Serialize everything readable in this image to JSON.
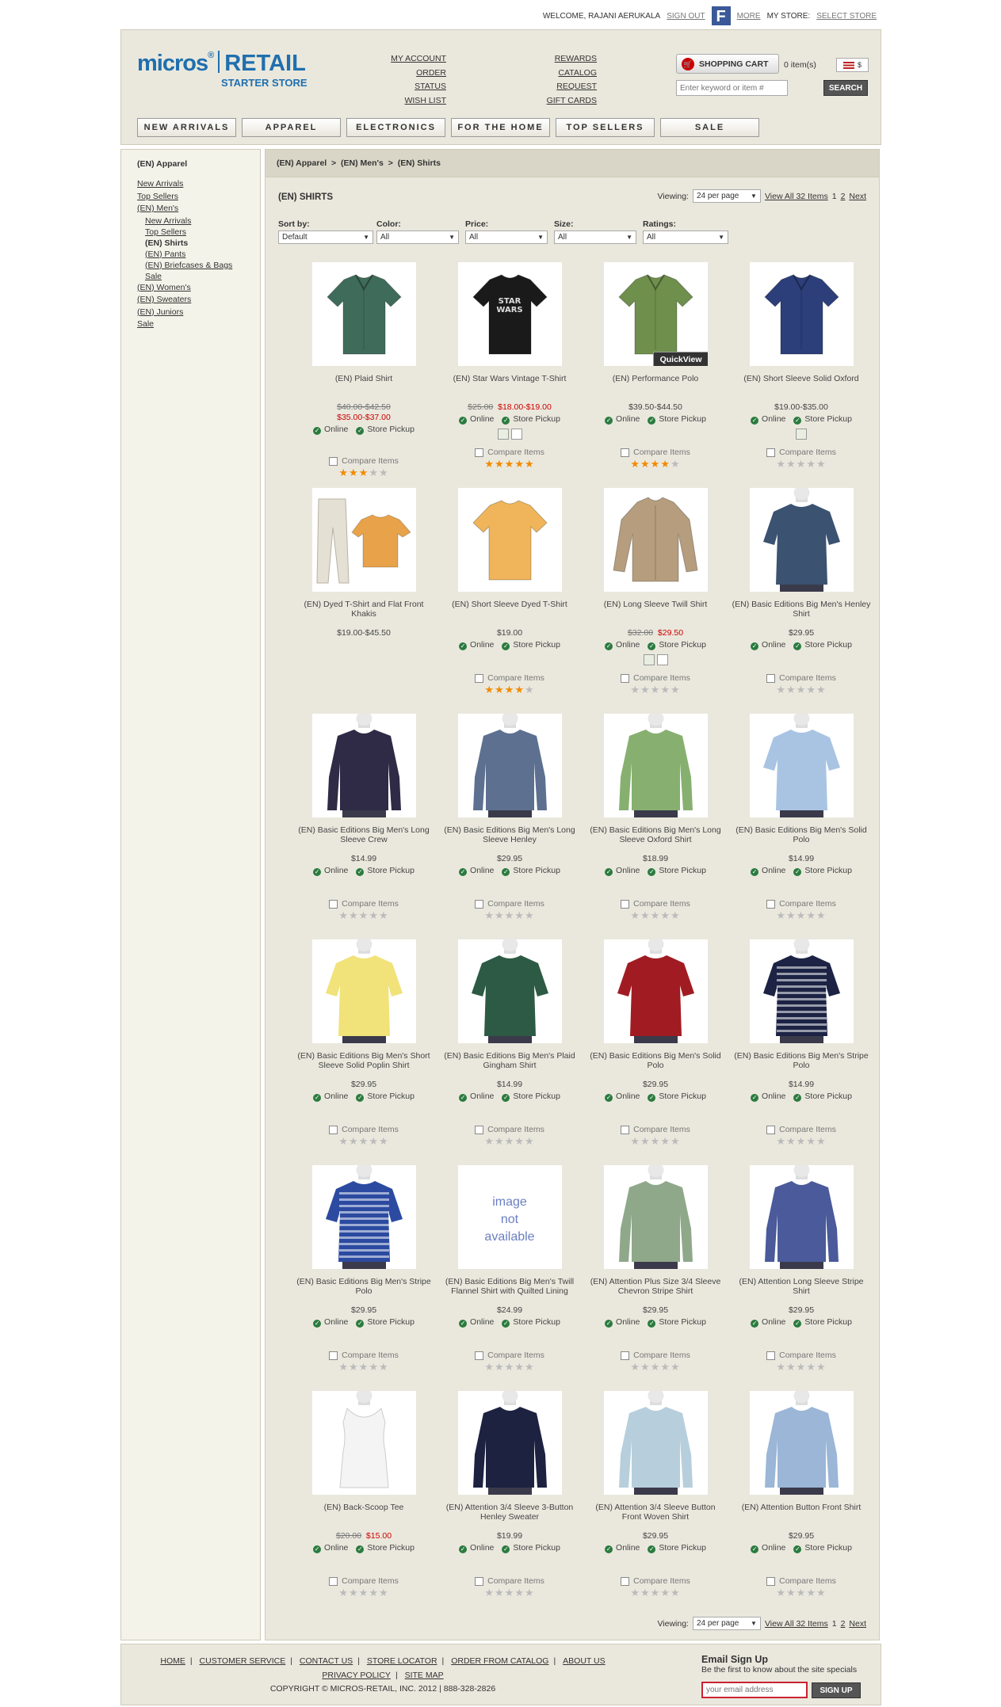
{
  "topbar": {
    "welcome": "WELCOME, RAJANI AERUKALA",
    "sign_out": "SIGN OUT",
    "fb_more": "MORE",
    "my_store": "MY STORE:",
    "select_store": "SELECT STORE"
  },
  "logo": {
    "brand": "micros",
    "brand2": "RETAIL",
    "tagline": "STARTER STORE"
  },
  "account_links": [
    "MY ACCOUNT",
    "ORDER STATUS",
    "WISH LIST"
  ],
  "account_links2": [
    "REWARDS",
    "CATALOG REQUEST",
    "GIFT CARDS"
  ],
  "cart": {
    "label": "SHOPPING CART",
    "items": "0 item(s)",
    "currency": "$"
  },
  "search": {
    "placeholder": "Enter keyword or item #",
    "button": "SEARCH"
  },
  "nav": [
    "NEW ARRIVALS",
    "APPAREL",
    "ELECTRONICS",
    "FOR THE HOME",
    "TOP SELLERS",
    "SALE"
  ],
  "sidebar": {
    "heading": "(EN) Apparel",
    "links": [
      {
        "label": "New Arrivals",
        "level": 0
      },
      {
        "label": "Top Sellers",
        "level": 0
      },
      {
        "label": "(EN) Men's",
        "level": 0
      },
      {
        "label": "New Arrivals",
        "level": 1
      },
      {
        "label": "Top Sellers",
        "level": 1
      },
      {
        "label": "(EN) Shirts",
        "level": 1,
        "current": true
      },
      {
        "label": "(EN) Pants",
        "level": 1
      },
      {
        "label": "(EN) Briefcases & Bags",
        "level": 1
      },
      {
        "label": "Sale",
        "level": 1
      },
      {
        "label": "(EN) Women's",
        "level": 0
      },
      {
        "label": "(EN) Sweaters",
        "level": 0
      },
      {
        "label": "(EN) Juniors",
        "level": 0
      },
      {
        "label": "Sale",
        "level": 0
      }
    ]
  },
  "breadcrumb": [
    "(EN) Apparel",
    ">",
    "(EN) Men's",
    ">",
    "(EN) Shirts"
  ],
  "page_title": "(EN) SHIRTS",
  "viewing": {
    "label": "Viewing:",
    "per_page": "24 per page",
    "view_all": "View All 32 Items",
    "page1": "1",
    "page2": "2",
    "next": "Next"
  },
  "filters": [
    {
      "label": "Sort by:",
      "value": "Default"
    },
    {
      "label": "Color:",
      "value": "All"
    },
    {
      "label": "Price:",
      "value": "All"
    },
    {
      "label": "Size:",
      "value": "All"
    },
    {
      "label": "Ratings:",
      "value": "All"
    }
  ],
  "labels": {
    "online": "Online",
    "pickup": "Store Pickup",
    "compare": "Compare Items",
    "quickview": "QuickView",
    "no_image": "image not available"
  },
  "products": [
    {
      "name": "(EN) Plaid Shirt",
      "old": "$40.00-$42.50",
      "price": "$35.00-$37.00",
      "sale": true,
      "avail": true,
      "stars": 3,
      "rated": true,
      "swatches": 0,
      "color": "#3f6b5a",
      "shape": "shirt"
    },
    {
      "name": "(EN) Star Wars Vintage T-Shirt",
      "old": "$25.00",
      "price": "$18.00-$19.00",
      "sale": true,
      "inline": true,
      "avail": true,
      "stars": 5,
      "rated": true,
      "swatches": 2,
      "color": "#1a1a1a",
      "shape": "tee",
      "logo": "STAR WARS"
    },
    {
      "name": "(EN) Performance Polo",
      "price": "$39.50-$44.50",
      "avail": true,
      "stars": 4,
      "rated": true,
      "swatches": 0,
      "color": "#6f8f4c",
      "shape": "polo",
      "quickview": true
    },
    {
      "name": "(EN) Short Sleeve Solid Oxford",
      "price": "$19.00-$35.00",
      "avail": true,
      "stars": 0,
      "rated": false,
      "swatches": 1,
      "color": "#2c3f7a",
      "shape": "shirt"
    },
    {
      "name": "(EN) Dyed T-Shirt and Flat Front Khakis",
      "price": "$19.00-$45.50",
      "avail": false,
      "noCompare": true,
      "swatches": 0,
      "color": "#e8a24a",
      "shape": "combo"
    },
    {
      "name": "(EN) Short Sleeve Dyed T-Shirt",
      "price": "$19.00",
      "avail": true,
      "stars": 3.5,
      "rated": true,
      "swatches": 0,
      "color": "#f0b55a",
      "shape": "tee"
    },
    {
      "name": "(EN) Long Sleeve Twill Shirt",
      "old": "$32.00",
      "price": "$29.50",
      "sale": true,
      "inline": true,
      "avail": true,
      "stars": 0,
      "rated": false,
      "swatches": 2,
      "color": "#b59d7e",
      "shape": "long"
    },
    {
      "name": "(EN) Basic Editions Big Men's Henley Shirt",
      "price": "$29.95",
      "avail": true,
      "stars": 0,
      "rated": false,
      "swatches": 0,
      "color": "#3b5271",
      "shape": "model"
    },
    {
      "name": "(EN) Basic Editions Big Men's Long Sleeve Crew",
      "price": "$14.99",
      "avail": true,
      "stars": 0,
      "rated": false,
      "swatches": 0,
      "color": "#2f2a45",
      "shape": "modellong"
    },
    {
      "name": "(EN) Basic Editions Big Men's Long Sleeve Henley",
      "price": "$29.95",
      "avail": true,
      "stars": 0,
      "rated": false,
      "swatches": 0,
      "color": "#5d7090",
      "shape": "modellong"
    },
    {
      "name": "(EN) Basic Editions Big Men's Long Sleeve Oxford Shirt",
      "price": "$18.99",
      "avail": true,
      "stars": 0,
      "rated": false,
      "swatches": 0,
      "color": "#87b070",
      "shape": "modellong"
    },
    {
      "name": "(EN) Basic Editions Big Men's Solid Polo",
      "price": "$14.99",
      "avail": true,
      "stars": 0,
      "rated": false,
      "swatches": 0,
      "color": "#a9c4e3",
      "shape": "model"
    },
    {
      "name": "(EN) Basic Editions Big Men's Short Sleeve Solid Poplin Shirt",
      "price": "$29.95",
      "avail": true,
      "stars": 0,
      "rated": false,
      "swatches": 0,
      "color": "#f1e27a",
      "shape": "model"
    },
    {
      "name": "(EN) Basic Editions Big Men's Plaid Gingham Shirt",
      "price": "$14.99",
      "avail": true,
      "stars": 0,
      "rated": false,
      "swatches": 0,
      "color": "#2d5a44",
      "shape": "model"
    },
    {
      "name": "(EN) Basic Editions Big Men's Solid Polo",
      "price": "$29.95",
      "avail": true,
      "stars": 0,
      "rated": false,
      "swatches": 0,
      "color": "#a01c22",
      "shape": "model"
    },
    {
      "name": "(EN) Basic Editions Big Men's Stripe Polo",
      "price": "$14.99",
      "avail": true,
      "stars": 0,
      "rated": false,
      "swatches": 0,
      "color": "#1c2344",
      "shape": "modelstripe"
    },
    {
      "name": "(EN) Basic Editions Big Men's Stripe Polo",
      "price": "$29.95",
      "avail": true,
      "stars": 0,
      "rated": false,
      "swatches": 0,
      "color": "#2c4aa0",
      "shape": "modelstripe"
    },
    {
      "name": "(EN) Basic Editions Big Men's Twill Flannel Shirt with Quilted Lining",
      "price": "$24.99",
      "avail": true,
      "stars": 0,
      "rated": false,
      "swatches": 0,
      "color": "#ffffff",
      "shape": "none"
    },
    {
      "name": "(EN) Attention Plus Size 3/4 Sleeve Chevron Stripe Shirt",
      "price": "$29.95",
      "avail": true,
      "stars": 0,
      "rated": false,
      "swatches": 0,
      "color": "#8fa88a",
      "shape": "womanlong"
    },
    {
      "name": "(EN) Attention Long Sleeve Stripe Shirt",
      "price": "$29.95",
      "avail": true,
      "stars": 0,
      "rated": false,
      "swatches": 0,
      "color": "#4a5a9a",
      "shape": "modellong"
    },
    {
      "name": "(EN) Back-Scoop Tee",
      "old": "$20.00",
      "price": "$15.00",
      "sale": true,
      "inline": true,
      "avail": true,
      "stars": 0,
      "rated": false,
      "swatches": 0,
      "color": "#f4f4f4",
      "shape": "tank"
    },
    {
      "name": "(EN) Attention 3/4 Sleeve 3-Button Henley Sweater",
      "price": "$19.99",
      "avail": true,
      "stars": 0,
      "rated": false,
      "swatches": 0,
      "color": "#1c2240",
      "shape": "womanlong"
    },
    {
      "name": "(EN) Attention 3/4 Sleeve Button Front Woven Shirt",
      "price": "$29.95",
      "avail": true,
      "stars": 0,
      "rated": false,
      "swatches": 0,
      "color": "#b7cfdc",
      "shape": "womanlong"
    },
    {
      "name": "(EN) Attention Button Front Shirt",
      "price": "$29.95",
      "avail": true,
      "stars": 0,
      "rated": false,
      "swatches": 0,
      "color": "#9bb6d6",
      "shape": "womanlong"
    }
  ],
  "footer": {
    "links": [
      "HOME",
      "CUSTOMER SERVICE",
      "CONTACT US",
      "STORE LOCATOR",
      "ORDER FROM CATALOG",
      "ABOUT US"
    ],
    "links2": [
      "PRIVACY POLICY",
      "SITE MAP"
    ],
    "copyright": "COPYRIGHT © MICROS-RETAIL, INC. 2012 | 888-328-2826",
    "email_title": "Email Sign Up",
    "email_sub": "Be the first to know about the site specials",
    "email_placeholder": "your email address",
    "email_button": "SIGN UP"
  }
}
